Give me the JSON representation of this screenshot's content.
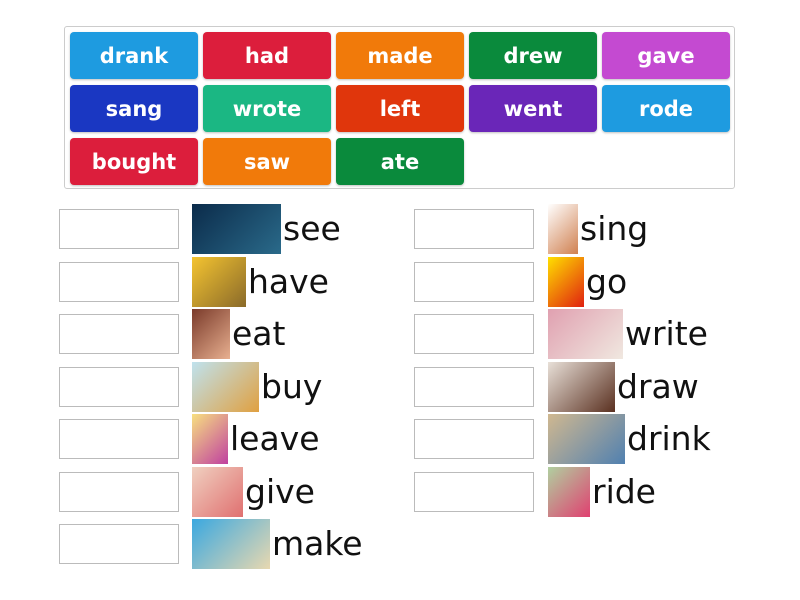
{
  "tiles": [
    {
      "label": "drank",
      "color": "#1e9be0"
    },
    {
      "label": "had",
      "color": "#dc1e3c"
    },
    {
      "label": "made",
      "color": "#f17a0a"
    },
    {
      "label": "drew",
      "color": "#0a8a3c"
    },
    {
      "label": "gave",
      "color": "#c44ad1"
    },
    {
      "label": "sang",
      "color": "#1a37c2"
    },
    {
      "label": "wrote",
      "color": "#1bb783"
    },
    {
      "label": "left",
      "color": "#e0360c"
    },
    {
      "label": "went",
      "color": "#6a26b8"
    },
    {
      "label": "rode",
      "color": "#1e9be0"
    },
    {
      "label": "bought",
      "color": "#dc1e3c"
    },
    {
      "label": "saw",
      "color": "#f17a0a"
    },
    {
      "label": "ate",
      "color": "#0a8a3c"
    }
  ],
  "left_items": [
    {
      "word": "see",
      "icon": "eye-image",
      "colors": [
        "#0b2b4a",
        "#2a6a8a"
      ]
    },
    {
      "word": "have",
      "icon": "men-image",
      "colors": [
        "#f4c430",
        "#8a6a2a"
      ]
    },
    {
      "word": "eat",
      "icon": "girl-eating-image",
      "colors": [
        "#7a3a2a",
        "#e8b090"
      ]
    },
    {
      "word": "buy",
      "icon": "shopping-image",
      "colors": [
        "#bfe2ee",
        "#e0a040"
      ]
    },
    {
      "word": "leave",
      "icon": "girl-suitcase-image",
      "colors": [
        "#f7e080",
        "#c040a0"
      ]
    },
    {
      "word": "give",
      "icon": "gift-image",
      "colors": [
        "#f0d0c0",
        "#e07070"
      ]
    },
    {
      "word": "make",
      "icon": "beach-image",
      "colors": [
        "#3aa8e0",
        "#e8d8b0"
      ]
    }
  ],
  "right_items": [
    {
      "word": "sing",
      "icon": "singing-girl-image",
      "colors": [
        "#ffffff",
        "#d08050"
      ]
    },
    {
      "word": "go",
      "icon": "go-sign-image",
      "colors": [
        "#ffe000",
        "#e02010"
      ]
    },
    {
      "word": "write",
      "icon": "writing-image",
      "colors": [
        "#e0a0b0",
        "#f0e8e0"
      ]
    },
    {
      "word": "draw",
      "icon": "drawing-image",
      "colors": [
        "#e8e0d8",
        "#5a3020"
      ]
    },
    {
      "word": "drink",
      "icon": "drinking-image",
      "colors": [
        "#d0b890",
        "#5080b0"
      ]
    },
    {
      "word": "ride",
      "icon": "bike-image",
      "colors": [
        "#b0d0a0",
        "#e04070"
      ]
    }
  ]
}
